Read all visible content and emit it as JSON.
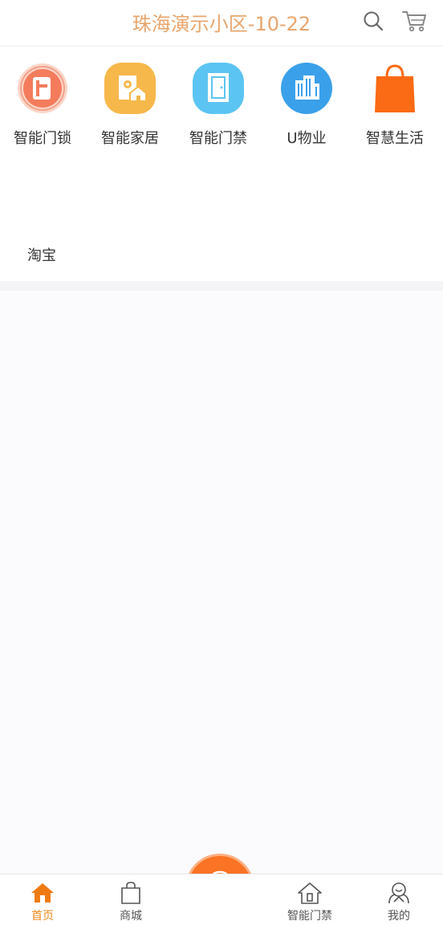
{
  "header": {
    "title": "珠海演示小区-10-22",
    "search_icon": "search-icon",
    "cart_icon": "cart-icon"
  },
  "quick_menu": {
    "items": [
      {
        "label": "智能门锁",
        "icon": "door-lock-icon"
      },
      {
        "label": "智能家居",
        "icon": "smart-home-icon"
      },
      {
        "label": "智能门禁",
        "icon": "door-access-icon"
      },
      {
        "label": "U物业",
        "icon": "building-icon"
      },
      {
        "label": "智慧生活",
        "icon": "shopping-bag-icon"
      }
    ],
    "link": "淘宝"
  },
  "tabbar": {
    "items": [
      {
        "label": "首页",
        "icon": "home-icon",
        "active": true
      },
      {
        "label": "商城",
        "icon": "shopping-bag-outline-icon",
        "active": false
      },
      {
        "label": "智能门禁",
        "icon": "house-outline-icon",
        "active": false
      },
      {
        "label": "我的",
        "icon": "user-icon",
        "active": false
      }
    ],
    "center_button_icon": "unlock-icon"
  },
  "colors": {
    "title": "#e8a56c",
    "accent": "#fb7324",
    "active_tab": "#f08a1c"
  }
}
